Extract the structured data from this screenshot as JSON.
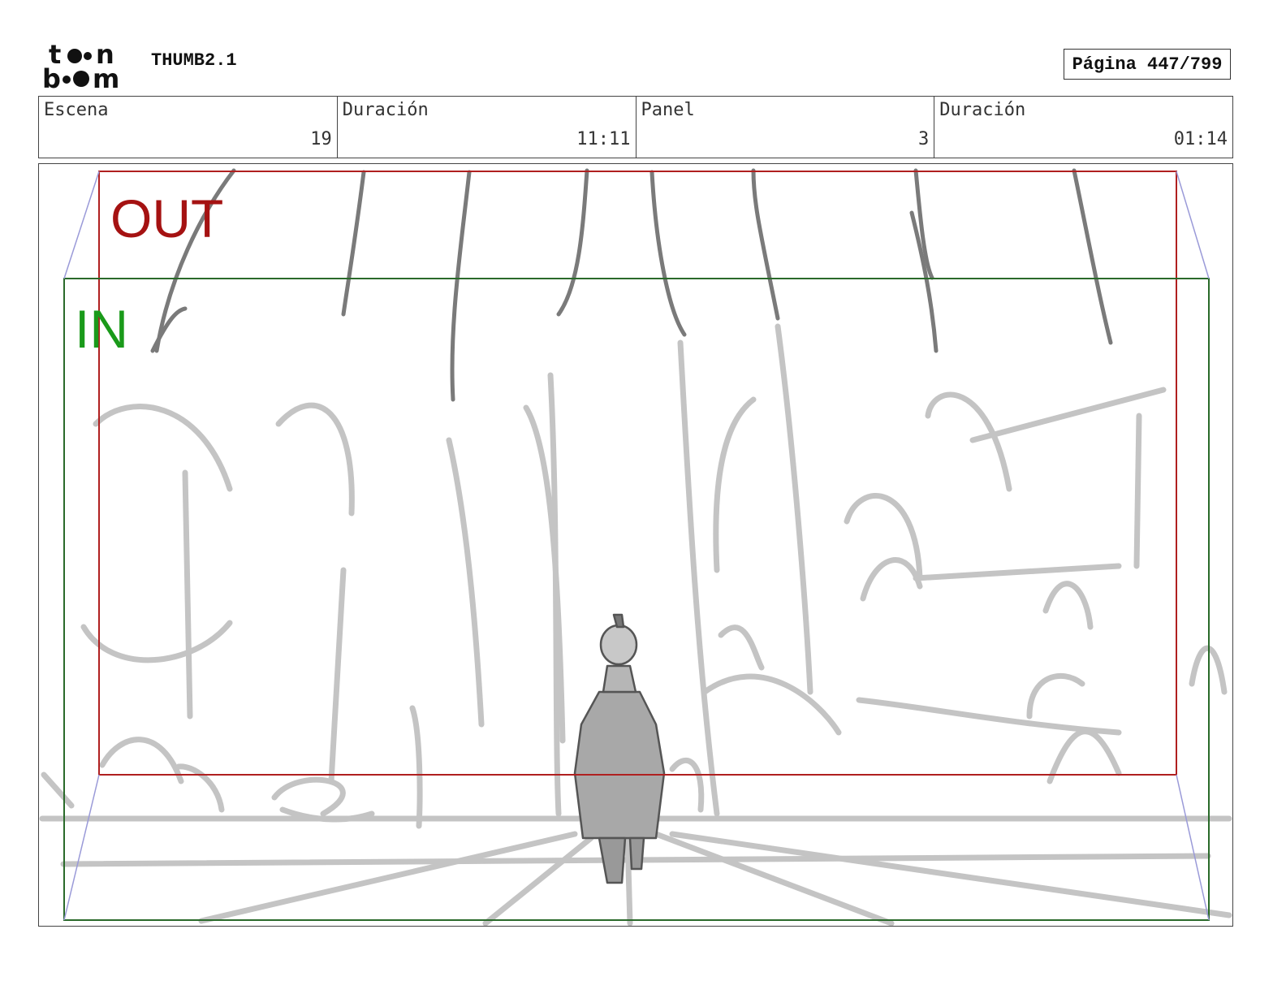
{
  "header": {
    "logo_text": "toon boom",
    "title": "THUMB2.1",
    "page_label": "Página 447/799"
  },
  "info": {
    "scene_label": "Escena",
    "scene_value": "19",
    "scene_duration_label": "Duración",
    "scene_duration_value": "11:11",
    "panel_label": "Panel",
    "panel_value": "3",
    "panel_duration_label": "Duración",
    "panel_duration_value": "01:14"
  },
  "frame": {
    "out_label": "OUT",
    "in_label": "IN",
    "out_color": "#a51212",
    "in_color": "#1a9a1a",
    "out_frame_color": "#b02020",
    "in_frame_color": "#2a6a2a",
    "guide_color": "#9a9ad8",
    "sketch_color": "#c4c4c4",
    "sketch_dark_color": "#7a7a7a"
  }
}
